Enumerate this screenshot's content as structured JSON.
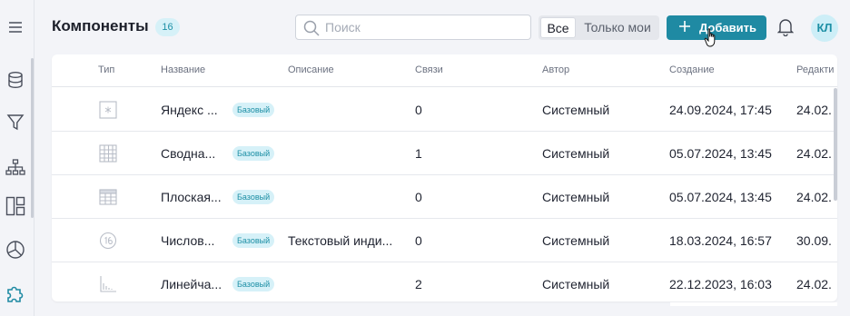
{
  "page": {
    "title": "Компоненты",
    "count": "16"
  },
  "sidebar": {
    "items": [
      {
        "icon": "menu-icon"
      },
      {
        "icon": "database-icon"
      },
      {
        "icon": "filter-icon"
      },
      {
        "icon": "hierarchy-icon"
      },
      {
        "icon": "dashboard-layout-icon"
      },
      {
        "icon": "pie-chart-icon"
      },
      {
        "icon": "puzzle-icon",
        "active": true
      }
    ]
  },
  "search": {
    "placeholder": "Поиск",
    "value": ""
  },
  "filter": {
    "all_label": "Все",
    "mine_label": "Только мои",
    "selected": "Все"
  },
  "add_button": {
    "label": "Добавить"
  },
  "user": {
    "initials": "КЛ"
  },
  "colors": {
    "accent": "#1f8aa3",
    "tag_bg": "#d6f1f8",
    "tag_text": "#1d8fa5"
  },
  "table": {
    "columns": [
      "Тип",
      "Название",
      "Описание",
      "Связи",
      "Автор",
      "Создание",
      "Редакти"
    ],
    "rows": [
      {
        "type_icon": "placeholder-icon",
        "name": "Яндекс ...",
        "tag": "Базовый",
        "description": "",
        "links": "0",
        "author": "Системный",
        "created": "24.09.2024, 17:45",
        "edited": "24.02."
      },
      {
        "type_icon": "pivot-table-icon",
        "name": "Сводна...",
        "tag": "Базовый",
        "description": "",
        "links": "1",
        "author": "Системный",
        "created": "05.07.2024, 13:45",
        "edited": "24.02."
      },
      {
        "type_icon": "flat-table-icon",
        "name": "Плоская...",
        "tag": "Базовый",
        "description": "",
        "links": "0",
        "author": "Системный",
        "created": "05.07.2024, 13:45",
        "edited": "24.02."
      },
      {
        "type_icon": "number-indicator-icon",
        "name": "Числов...",
        "tag": "Базовый",
        "description": "Текстовый инди...",
        "links": "0",
        "author": "Системный",
        "created": "18.03.2024, 16:57",
        "edited": "30.09."
      },
      {
        "type_icon": "line-chart-icon",
        "name": "Линейча...",
        "tag": "Базовый",
        "description": "",
        "links": "2",
        "author": "Системный",
        "created": "22.12.2023, 16:03",
        "edited": "24.02."
      }
    ]
  }
}
